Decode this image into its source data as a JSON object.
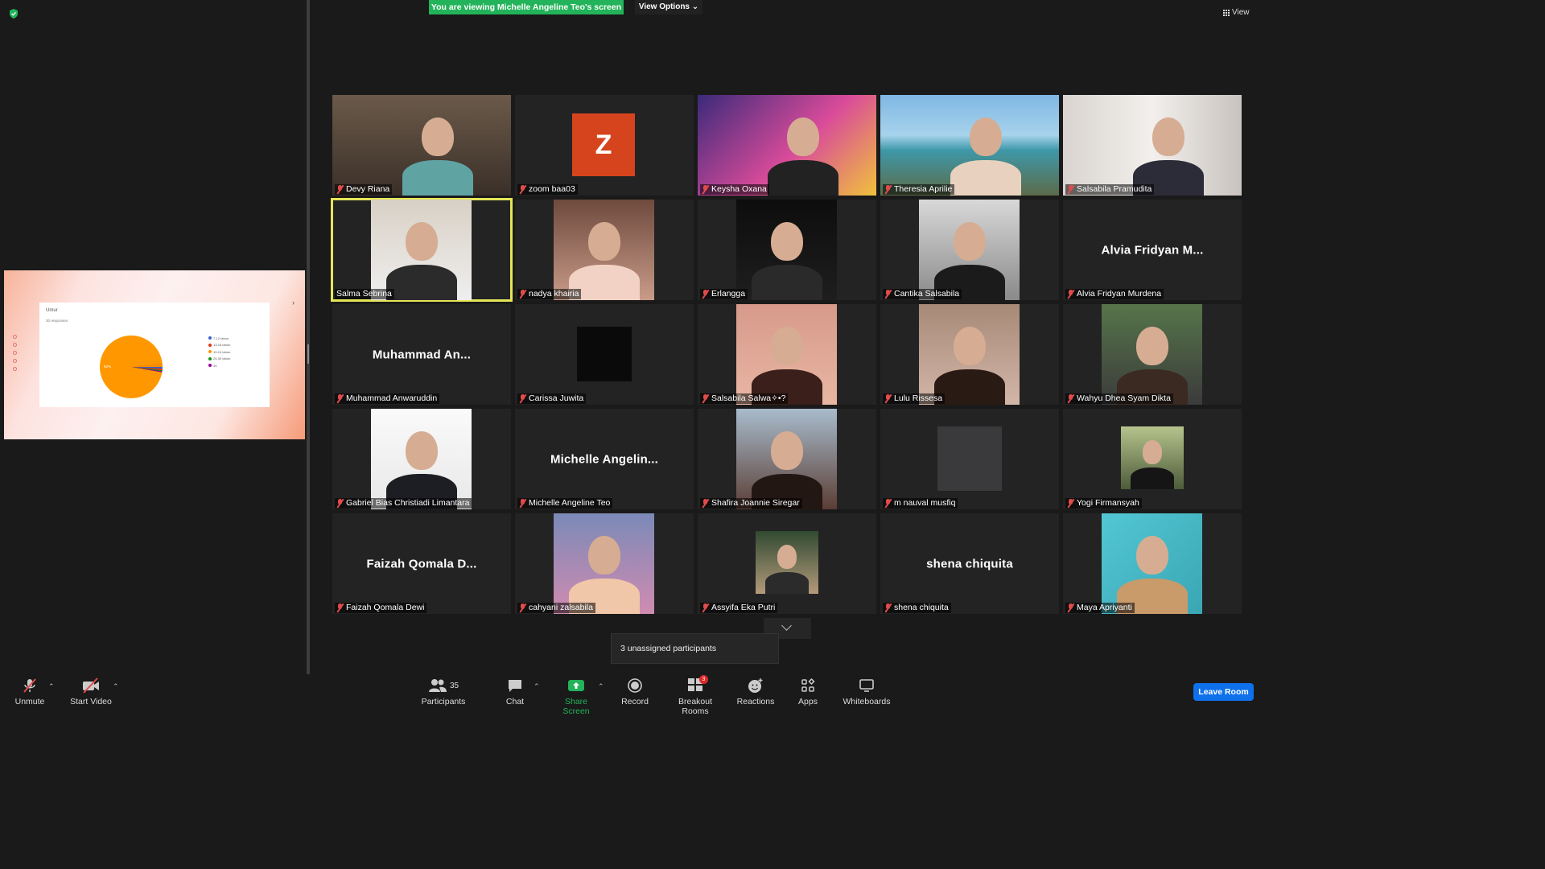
{
  "banner": {
    "viewing_text": "You are viewing Michelle Angeline Teo's screen",
    "view_options": "View Options ⌄",
    "view_label": "View"
  },
  "shared_slide": {
    "title": "Umur",
    "subtitle": "30 responses",
    "pie_label": "92%",
    "legend": [
      "7-12 tahun",
      "13-18 tahun",
      "19-24 tahun",
      "25-30 tahun",
      "34"
    ],
    "legend_colors": [
      "#3366cc",
      "#dc3912",
      "#ff9900",
      "#109618",
      "#990099"
    ]
  },
  "participants": [
    {
      "name": "Devy Riana",
      "big": ""
    },
    {
      "name": "zoom baa03",
      "big": "",
      "avatar": "Z"
    },
    {
      "name": "Keysha Oxana",
      "big": ""
    },
    {
      "name": "Theresia Aprilie",
      "big": ""
    },
    {
      "name": "Salsabila Pramudita",
      "big": ""
    },
    {
      "name": "Salma Sebrina",
      "big": ""
    },
    {
      "name": "nadya khairia",
      "big": ""
    },
    {
      "name": "Erlangga",
      "big": ""
    },
    {
      "name": "Cantika Salsabila",
      "big": ""
    },
    {
      "name": "Alvia Fridyan Murdena",
      "big": "Alvia  Fridyan  M..."
    },
    {
      "name": "Muhammad Anwaruddin",
      "big": "Muhammad  An..."
    },
    {
      "name": "Carissa Juwita",
      "big": ""
    },
    {
      "name": "Salsabila Salwa✧•?",
      "big": ""
    },
    {
      "name": "Lulu Rissesa",
      "big": ""
    },
    {
      "name": "Wahyu Dhea Syam Dikta",
      "big": ""
    },
    {
      "name": "Gabriel Bias Christiadi Limantara",
      "big": ""
    },
    {
      "name": "Michelle Angeline Teo",
      "big": "Michelle  Angelin..."
    },
    {
      "name": "Shafira Joannie Siregar",
      "big": ""
    },
    {
      "name": "m nauval musfiq",
      "big": ""
    },
    {
      "name": "Yogi Firmansyah",
      "big": ""
    },
    {
      "name": "Faizah Qomala Dewi",
      "big": "Faizah  Qomala  D..."
    },
    {
      "name": "cahyani zalsabila",
      "big": ""
    },
    {
      "name": "Assyifa Eka Putri",
      "big": ""
    },
    {
      "name": "shena chiquita",
      "big": "shena  chiquita"
    },
    {
      "name": "Maya Apriyanti",
      "big": ""
    }
  ],
  "unassigned": "3 unassigned participants",
  "toolbar": {
    "unmute": "Unmute",
    "start_video": "Start Video",
    "participants": "Participants",
    "participants_count": "35",
    "chat": "Chat",
    "share_screen": "Share Screen",
    "record": "Record",
    "breakout_rooms": "Breakout Rooms",
    "breakout_badge": "3",
    "reactions": "Reactions",
    "apps": "Apps",
    "whiteboards": "Whiteboards",
    "leave_room": "Leave Room"
  },
  "colors": {
    "share_green": "#23b35a",
    "leave_blue": "#0e71eb",
    "muted_red": "#e24b4b",
    "active_speaker": "#e5e657"
  }
}
